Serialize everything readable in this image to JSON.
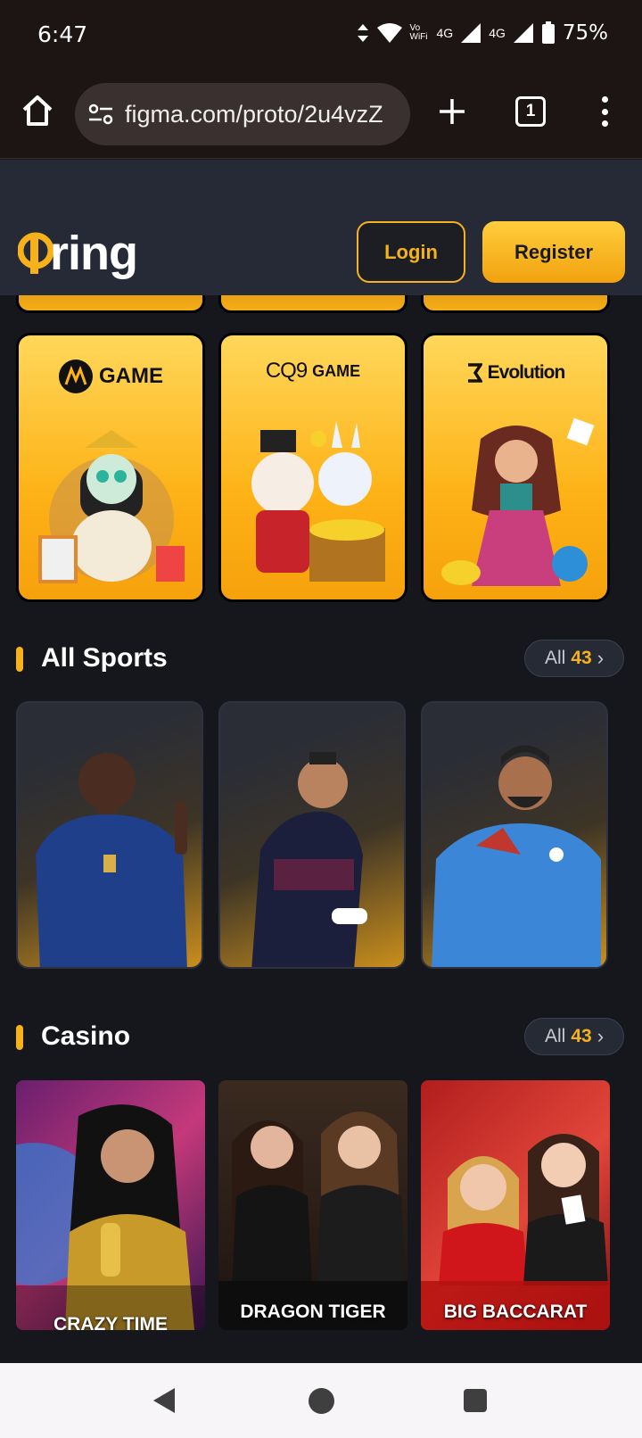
{
  "status_bar": {
    "time": "6:47",
    "network_1": "4G",
    "network_2": "4G",
    "vowifi": "Vo WiFi",
    "battery": "75%"
  },
  "browser": {
    "url": "figma.com/proto/2u4vzZ",
    "tab_count": "1"
  },
  "header": {
    "logo_text": "fring",
    "login_label": "Login",
    "register_label": "Register"
  },
  "providers": [
    {
      "name": "GAME",
      "icon": "microgaming-m-icon"
    },
    {
      "name": "GAME",
      "prefix": "CQ9",
      "icon": "cq9-logo"
    },
    {
      "name": "Evolution",
      "icon": "evolution-e-icon"
    }
  ],
  "sports": {
    "title": "All Sports",
    "all_label": "All",
    "count": "43"
  },
  "casino": {
    "title": "Casino",
    "all_label": "All",
    "count": "43",
    "games": [
      {
        "label": "CRAZY TIME"
      },
      {
        "label": "DRAGON TIGER"
      },
      {
        "label": "BIG BACCARAT"
      }
    ]
  },
  "colors": {
    "accent": "#f7b21b",
    "header_bg": "#262a36",
    "page_bg": "#15171c"
  }
}
